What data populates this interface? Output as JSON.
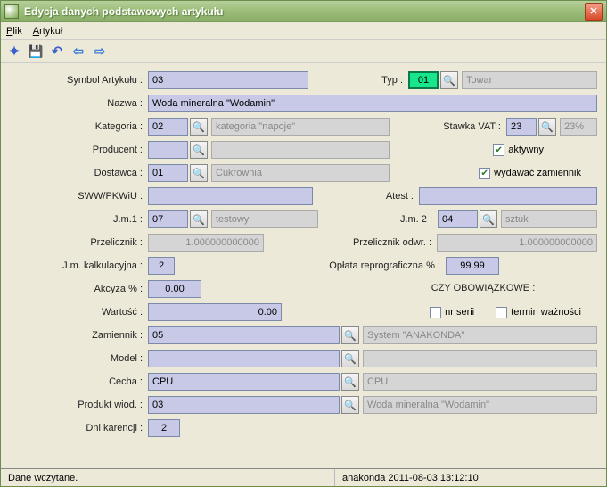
{
  "window": {
    "title": "Edycja danych podstawowych artykułu"
  },
  "menu": {
    "file": "Plik",
    "article": "Artykuł"
  },
  "labels": {
    "symbol": "Symbol Artykułu :",
    "typ": "Typ :",
    "nazwa": "Nazwa :",
    "kategoria": "Kategoria :",
    "stawka_vat": "Stawka VAT :",
    "producent": "Producent :",
    "dostawca": "Dostawca :",
    "sww": "SWW/PKWiU :",
    "atest": "Atest :",
    "jm1": "J.m.1 :",
    "jm2": "J.m. 2 :",
    "przelicznik": "Przelicznik :",
    "przelicznik_odwr": "Przelicznik odwr. :",
    "jm_kalk": "J.m. kalkulacyjna :",
    "oplata_repro": "Opłata reprograficzna % :",
    "akcyza": "Akcyza % :",
    "wartosc": "Wartość :",
    "zamiennik": "Zamiennik :",
    "model": "Model :",
    "cecha": "Cecha :",
    "produkt_wiod": "Produkt wiod. :",
    "dni_karencji": "Dni karencji :",
    "czy_obowiazkowe": "CZY OBOWIĄZKOWE :",
    "nr_serii": "nr serii",
    "termin_waznosci": "termin ważności",
    "aktywny": "aktywny",
    "wydawac_zamiennik": "wydawać zamiennik"
  },
  "values": {
    "symbol": "03",
    "typ": "01",
    "typ_desc": "Towar",
    "nazwa": "Woda mineralna \"Wodamin\"",
    "kategoria": "02",
    "kategoria_desc": "kategoria \"napoje\"",
    "stawka_vat": "23",
    "stawka_vat_desc": "23%",
    "producent": "",
    "producent_desc": "",
    "dostawca": "01",
    "dostawca_desc": "Cukrownia",
    "sww": "",
    "atest": "",
    "jm1": "07",
    "jm1_desc": "testowy",
    "jm2": "04",
    "jm2_desc": "sztuk",
    "przelicznik": "1.000000000000",
    "przelicznik_odwr": "1.000000000000",
    "jm_kalk": "2",
    "oplata_repro": "99.99",
    "akcyza": "0.00",
    "wartosc": "0.00",
    "zamiennik": "05",
    "zamiennik_desc": "System \"ANAKONDA\"",
    "model": "",
    "model_desc": "",
    "cecha": "CPU",
    "cecha_desc": "CPU",
    "produkt_wiod": "03",
    "produkt_wiod_desc": "Woda mineralna \"Wodamin\"",
    "dni_karencji": "2"
  },
  "checks": {
    "aktywny": true,
    "wydawac_zamiennik": true,
    "nr_serii": false,
    "termin_waznosci": false
  },
  "status": {
    "left": "Dane wczytane.",
    "right": "anakonda  2011-08-03 13:12:10"
  }
}
